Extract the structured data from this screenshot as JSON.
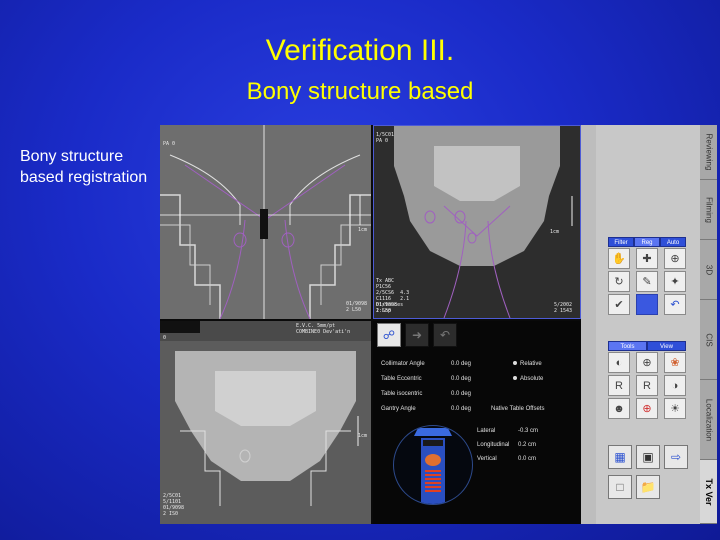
{
  "slide": {
    "title": "Verification III.",
    "subtitle": "Bony structure based",
    "caption": "Bony structure based registration"
  },
  "views": {
    "top_left": {
      "label": "PA 0",
      "ruler_label": "1cm",
      "footer": "01/9098\n2 L50"
    },
    "top_right": {
      "header": "1/5C01\nPA 0",
      "info": "Tx ABC\nP1C56\n2/5CS6  4.3\nC1116   2.1\nDistances\n1:Snp",
      "footer_left": "01/9098\n2 L50",
      "footer_right": "5/2002\n2 1543",
      "ruler_label": "1cm"
    },
    "bottom_left": {
      "header": "E.V.C. 5mm/pt\nCOMBINE0 Dev'ati'n",
      "label": "0",
      "footer": "2/5C01\n5/1101\n01/9098\n2 IS0",
      "ruler_label": "1cm"
    }
  },
  "panel": {
    "rows": [
      {
        "label": "Collimator Angle",
        "value": "0.0 deg",
        "option": "Relative"
      },
      {
        "label": "Table Eccentric",
        "value": "0.0 deg",
        "option": "Absolute"
      },
      {
        "label": "Table isocentric",
        "value": "0.0 deg",
        "option": ""
      },
      {
        "label": "Gantry Angle",
        "value": "0.0 deg",
        "option": ""
      }
    ],
    "offsets_title": "Native Table Offsets",
    "offsets": [
      {
        "label": "Lateral",
        "value": "-0.3 cm"
      },
      {
        "label": "Longitudinal",
        "value": "0.2 cm"
      },
      {
        "label": "Vertical",
        "value": "0.0 cm"
      }
    ]
  },
  "tool_panel": {
    "top_tabs": [
      "Filter",
      "Reg",
      "Auto"
    ],
    "mid_tabs": [
      "Tools",
      "View"
    ]
  },
  "side_tabs": [
    "Reviewing",
    "Filming",
    "3D",
    "CIS",
    "Localization",
    "Tx Ver"
  ],
  "colors": {
    "title": "#ffff00",
    "caption": "#ffffff",
    "contour": "#a060c0",
    "tab_accent": "#2f4fd8"
  }
}
